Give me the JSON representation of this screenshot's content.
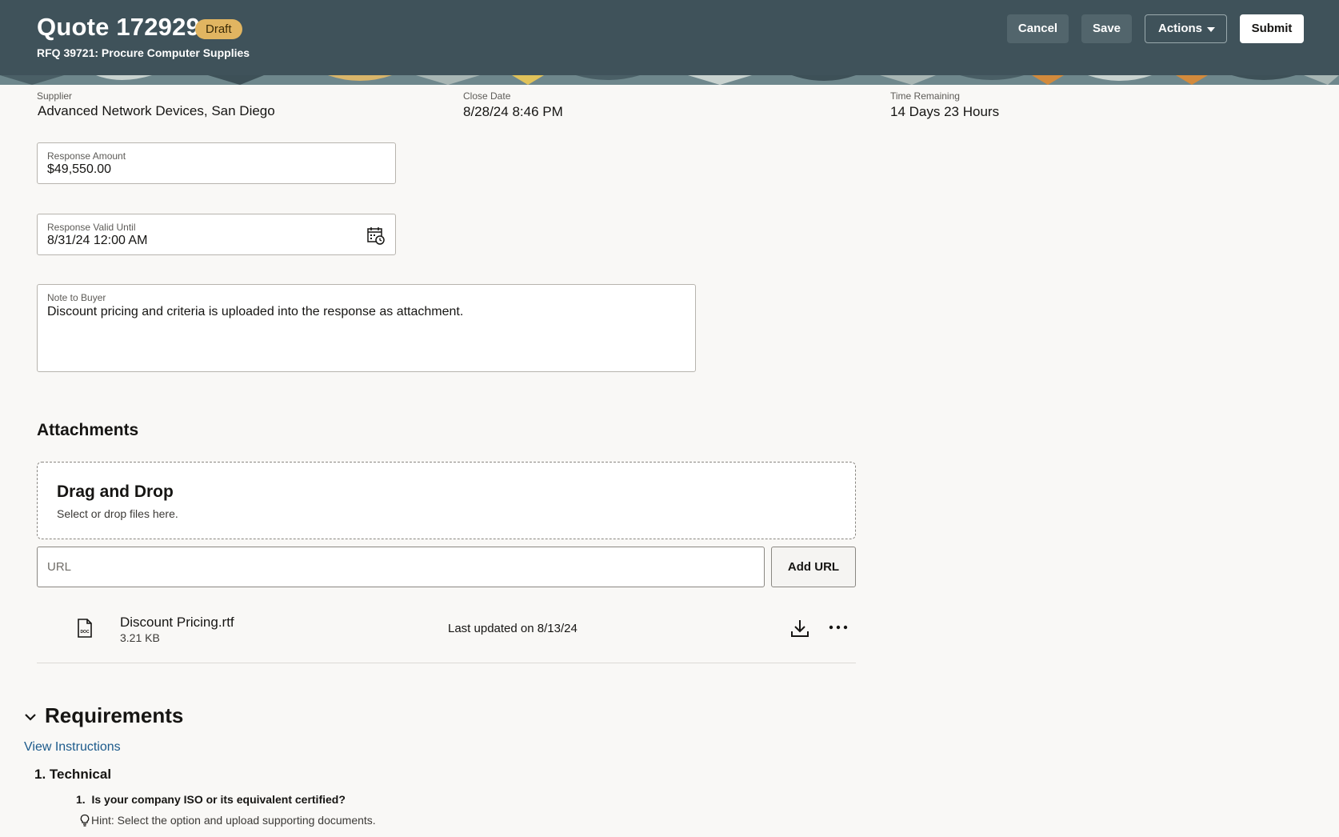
{
  "header": {
    "title": "Quote 172929",
    "status_badge": "Draft",
    "subtitle": "RFQ 39721: Procure Computer Supplies",
    "buttons": {
      "cancel": "Cancel",
      "save": "Save",
      "actions": "Actions",
      "submit": "Submit"
    }
  },
  "summary": {
    "supplier_label": "Supplier",
    "supplier_value": "Advanced Network Devices, San Diego",
    "close_date_label": "Close Date",
    "close_date_value": "8/28/24 8:46 PM",
    "time_remaining_label": "Time Remaining",
    "time_remaining_value": "14 Days 23 Hours"
  },
  "form": {
    "response_amount_label": "Response Amount",
    "response_amount_value": "$49,550.00",
    "valid_until_label": "Response Valid Until",
    "valid_until_value": "8/31/24 12:00 AM",
    "note_label": "Note to Buyer",
    "note_value": "Discount pricing and criteria is uploaded into the response as attachment."
  },
  "attachments": {
    "heading": "Attachments",
    "dropzone_title": "Drag and Drop",
    "dropzone_subtitle": "Select or drop files here.",
    "url_placeholder": "URL",
    "add_url_label": "Add URL",
    "files": [
      {
        "name": "Discount Pricing.rtf",
        "size": "3.21 KB",
        "updated": "Last updated on 8/13/24",
        "icon": "doc-file-icon"
      }
    ]
  },
  "requirements": {
    "heading": "Requirements",
    "view_instructions": "View Instructions",
    "sections": [
      {
        "title": "1. Technical",
        "questions": [
          {
            "number": "1.",
            "text": "Is your company ISO or its equivalent certified?",
            "hint": "Hint: Select the option and upload supporting documents."
          }
        ]
      }
    ]
  },
  "colors": {
    "header_bg": "#3f525a",
    "badge_bg": "#e1b561",
    "link": "#1c5a8b",
    "page_bg": "#f9f8f6"
  }
}
